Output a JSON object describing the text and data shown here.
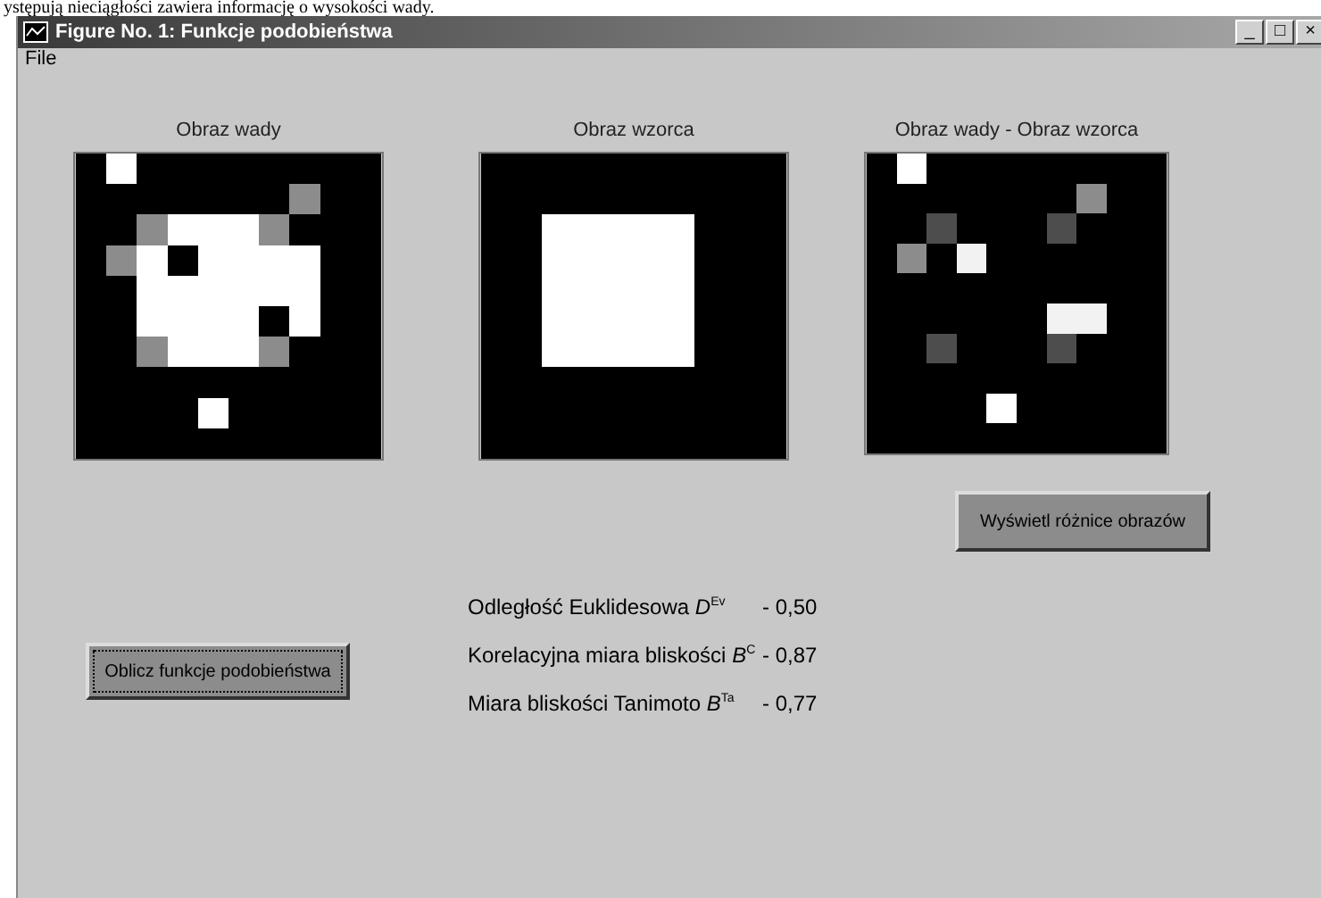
{
  "page_caption": "ystępują nieciągłości zawiera informację o wysokości wady.",
  "window": {
    "title": "Figure No. 1: Funkcje podobieństwa",
    "controls": [
      "_",
      "□",
      "×"
    ]
  },
  "menu": [
    "File"
  ],
  "plots": [
    {
      "title": "Obraz wady"
    },
    {
      "title": "Obraz wzorca"
    },
    {
      "title": "Obraz wady - Obraz wzorca"
    }
  ],
  "buttons": [
    {
      "label": "Wyświetl różnice obrazów"
    },
    {
      "label": "Oblicz funkcje podobieństwa",
      "focused": true
    }
  ],
  "measures": [
    {
      "label": "Odległość Euklidesowa *D*$^{Ev}$",
      "value": "- 0,50"
    },
    {
      "label": "Korelacyjna miara bliskości *B*$^{C}$",
      "value": "- 0,87"
    },
    {
      "label": "Miara bliskości Tanimoto *B*$^{Ta}$",
      "value": "- 0,77"
    }
  ]
}
